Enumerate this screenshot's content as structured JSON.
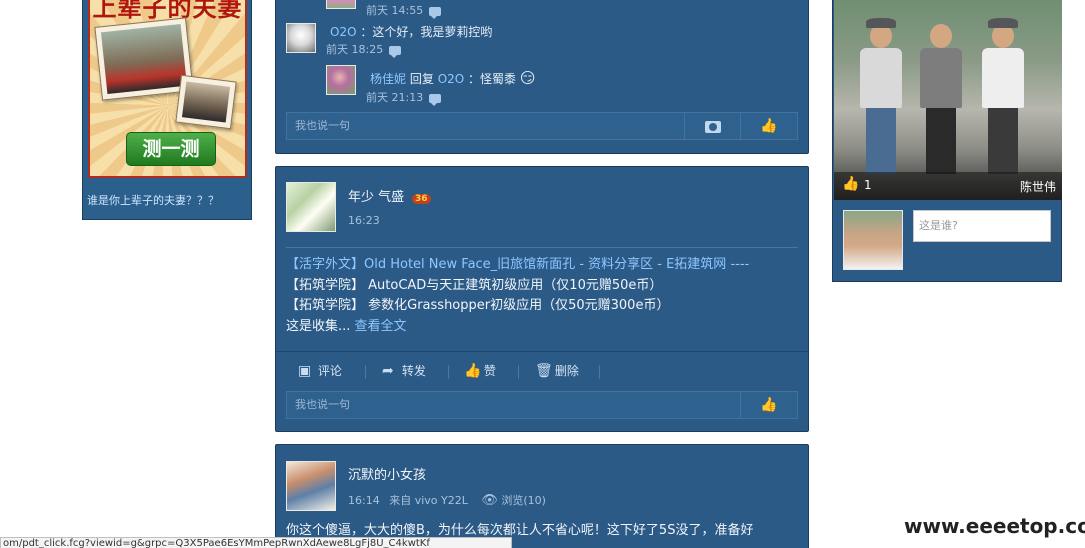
{
  "left_ad": {
    "title": "上辈子的夫妻",
    "button_label": "测一测",
    "caption": "谁是你上辈子的夫妻？？？"
  },
  "comments_card": {
    "first_time": "前天 14:55",
    "comments": [
      {
        "author": "O2O",
        "text": "：这个好，我是萝莉控哟",
        "time": "前天 18:25"
      },
      {
        "author": "杨佳妮",
        "reply_word": "回复",
        "reply_to": "O2O",
        "text": "：怪蜀黍",
        "emoji": "😏",
        "time": "前天 21:13"
      }
    ],
    "input_placeholder": "我也说一句"
  },
  "post_1": {
    "author": "年少 气盛",
    "badge": "36",
    "time": "16:23",
    "lines": [
      "【活字外文】Old Hotel New Face_旧旅馆新面孔 - 资料分享区 - E拓建筑网 ----",
      "【拓筑学院】 AutoCAD与天正建筑初级应用（仅10元赠50e币）",
      "【拓筑学院】 参数化Grasshopper初级应用（仅50元赠300e币）"
    ],
    "summary_prefix": "这是收集...",
    "read_more": "查看全文",
    "actions": {
      "comment": "评论",
      "forward": "转发",
      "like": "赞",
      "delete": "删除"
    },
    "input_placeholder": "我也说一句"
  },
  "post_2": {
    "author": "沉默的小女孩",
    "time": "16:14",
    "source": "来自 vivo Y22L",
    "views": "浏览(10)",
    "text": "你这个傻逼，大大的傻B，为什么每次都让人不省心呢！这下好了5S没了，准备好"
  },
  "right_widget": {
    "like_count": "1",
    "photo_name": "陈世伟",
    "who_placeholder": "这是谁?"
  },
  "status_bar": {
    "url": "om/pdt_click.fcg?viewid=g&grpc=Q3X5Pae6EsYMmPepRwnXdAewe8LgFj8U_C4kwtKf"
  },
  "watermark": "www.eeeetop.com",
  "colors": {
    "card_bg": "#2b5a87",
    "link": "#8ec8ff",
    "ad_button": "#2e8f2c"
  }
}
